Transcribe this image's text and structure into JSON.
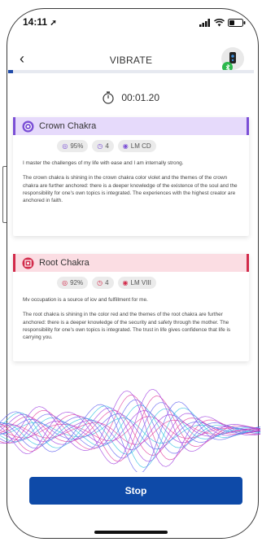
{
  "status": {
    "time": "14:11"
  },
  "nav": {
    "title": "VIBRATE"
  },
  "progress": {
    "fraction": 0.02
  },
  "timer": {
    "value": "00:01.20"
  },
  "cards": [
    {
      "title": "Crown Chakra",
      "accent": "#7b4fd6",
      "header_bg": "#e6dafb",
      "chips": [
        {
          "icon": "target-icon",
          "label": "95%"
        },
        {
          "icon": "dial-icon",
          "label": "4"
        },
        {
          "icon": "chakra-symbol-icon",
          "label": "LM CD"
        }
      ],
      "affirmation": "I master the challenges of my life with ease and I am internally strong.",
      "description": "The crown chakra is shining in the crown chakra color violet and the themes of the crown chakra are further anchored: there is a deeper knowledge of the existence of the soul and the responsibility for one's own topics is integrated. The experiences with the highest creator are anchored in faith."
    },
    {
      "title": "Root Chakra",
      "accent": "#d22a4a",
      "header_bg": "#fbdde3",
      "chips": [
        {
          "icon": "target-icon",
          "label": "92%"
        },
        {
          "icon": "dial-icon",
          "label": "4"
        },
        {
          "icon": "chakra-symbol-icon",
          "label": "LM VIII"
        }
      ],
      "affirmation": "Mv occupation is a source of iov and fulfillment for me.",
      "description": "The root chakra is shining in the color red and the themes of the root chakra are further anchored: there is a deeper knowledge of the security and safety through the mother. The responsibility for one's own topics is integrated. The trust in life gives confidence that life is carrying you."
    }
  ],
  "action": {
    "stop_label": "Stop",
    "color": "#0e4aa8"
  }
}
